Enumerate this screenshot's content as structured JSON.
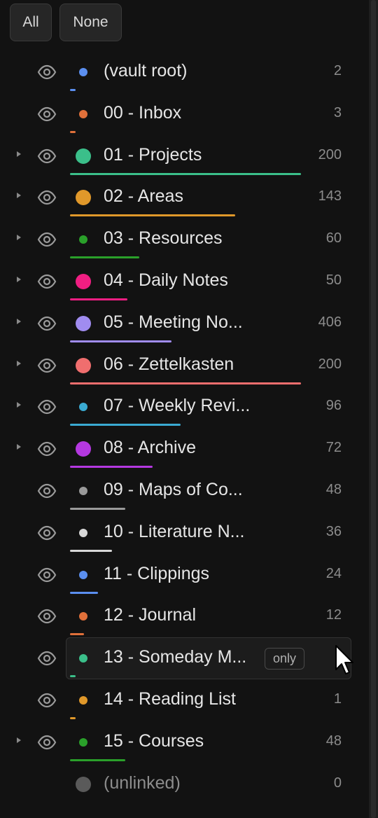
{
  "toolbar": {
    "all_label": "All",
    "none_label": "None"
  },
  "only_label": "only",
  "rows": [
    {
      "label": "(vault root)",
      "count": "2",
      "color": "#5b8ff0",
      "expandable": false,
      "dot": 12,
      "bar": 8
    },
    {
      "label": "00 - Inbox",
      "count": "3",
      "color": "#e0703a",
      "expandable": false,
      "dot": 12,
      "bar": 8
    },
    {
      "label": "01 - Projects",
      "count": "200",
      "color": "#3bbf8a",
      "expandable": true,
      "dot": 22,
      "bar": 330
    },
    {
      "label": "02 - Areas",
      "count": "143",
      "color": "#e0982a",
      "expandable": true,
      "dot": 22,
      "bar": 236
    },
    {
      "label": "03 - Resources",
      "count": "60",
      "color": "#2aa02a",
      "expandable": true,
      "dot": 12,
      "bar": 99
    },
    {
      "label": "04 - Daily Notes",
      "count": "50",
      "color": "#f01e82",
      "expandable": true,
      "dot": 22,
      "bar": 82
    },
    {
      "label": "05 - Meeting No...",
      "count": "406",
      "color": "#a08cf0",
      "expandable": true,
      "dot": 22,
      "bar": 145
    },
    {
      "label": "06 - Zettelkasten",
      "count": "200",
      "color": "#f06e6e",
      "expandable": true,
      "dot": 22,
      "bar": 330
    },
    {
      "label": "07 - Weekly Revi...",
      "count": "96",
      "color": "#3aaad2",
      "expandable": true,
      "dot": 12,
      "bar": 158
    },
    {
      "label": "08 - Archive",
      "count": "72",
      "color": "#b438e0",
      "expandable": true,
      "dot": 22,
      "bar": 118
    },
    {
      "label": "09 - Maps of Co...",
      "count": "48",
      "color": "#9a9a9a",
      "expandable": false,
      "dot": 12,
      "bar": 79
    },
    {
      "label": "10 - Literature N...",
      "count": "36",
      "color": "#d8d8d8",
      "expandable": false,
      "dot": 12,
      "bar": 60
    },
    {
      "label": "11 - Clippings",
      "count": "24",
      "color": "#5b8ff0",
      "expandable": false,
      "dot": 12,
      "bar": 40
    },
    {
      "label": "12 - Journal",
      "count": "12",
      "color": "#e0703a",
      "expandable": false,
      "dot": 12,
      "bar": 20
    },
    {
      "label": "13 - Someday M...",
      "count": "",
      "color": "#3bbf8a",
      "expandable": false,
      "dot": 12,
      "bar": 8,
      "hover": true
    },
    {
      "label": "14 - Reading List",
      "count": "1",
      "color": "#e0982a",
      "expandable": false,
      "dot": 12,
      "bar": 8
    },
    {
      "label": "15 - Courses",
      "count": "48",
      "color": "#2aa02a",
      "expandable": true,
      "dot": 12,
      "bar": 79
    },
    {
      "label": "(unlinked)",
      "count": "0",
      "color": "#5a5a5a",
      "expandable": false,
      "dot": 22,
      "bar": 0,
      "noeye": true
    }
  ]
}
